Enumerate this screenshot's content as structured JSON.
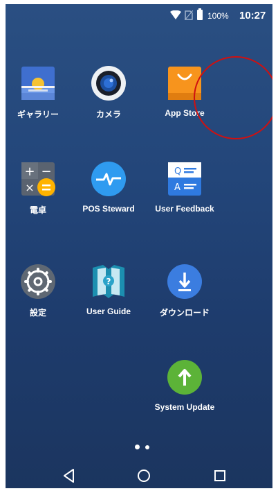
{
  "status_bar": {
    "battery_percent": "100%",
    "time": "10:27",
    "icons": [
      "wifi-icon",
      "no-sim-icon",
      "battery-icon"
    ]
  },
  "apps": [
    {
      "id": "gallery",
      "label": "ギャラリー",
      "icon": "gallery-icon"
    },
    {
      "id": "camera",
      "label": "カメラ",
      "icon": "camera-icon"
    },
    {
      "id": "app-store",
      "label": "App Store",
      "icon": "shopping-bag-icon",
      "highlighted": true
    },
    {
      "id": "calculator",
      "label": "電卓",
      "icon": "calculator-icon"
    },
    {
      "id": "pos-steward",
      "label": "POS Steward",
      "icon": "pulse-icon"
    },
    {
      "id": "user-feedback",
      "label": "User Feedback",
      "icon": "feedback-icon"
    },
    {
      "id": "settings",
      "label": "設定",
      "icon": "gear-icon"
    },
    {
      "id": "user-guide",
      "label": "User Guide",
      "icon": "guide-book-icon"
    },
    {
      "id": "downloads",
      "label": "ダウンロード",
      "icon": "download-icon"
    },
    {
      "id": "system-update",
      "label": "System Update",
      "icon": "update-arrow-icon"
    }
  ],
  "page_indicator": {
    "pages": 2,
    "current": 1
  },
  "nav_bar": {
    "buttons": [
      "back-icon",
      "home-icon",
      "recents-icon"
    ]
  },
  "colors": {
    "background_top": "#2a4f82",
    "background_bottom": "#1b355f",
    "highlight_ring": "#d01010",
    "app_store_orange": "#f7941d",
    "pos_blue": "#2f9bf0",
    "update_green": "#5cb338"
  }
}
